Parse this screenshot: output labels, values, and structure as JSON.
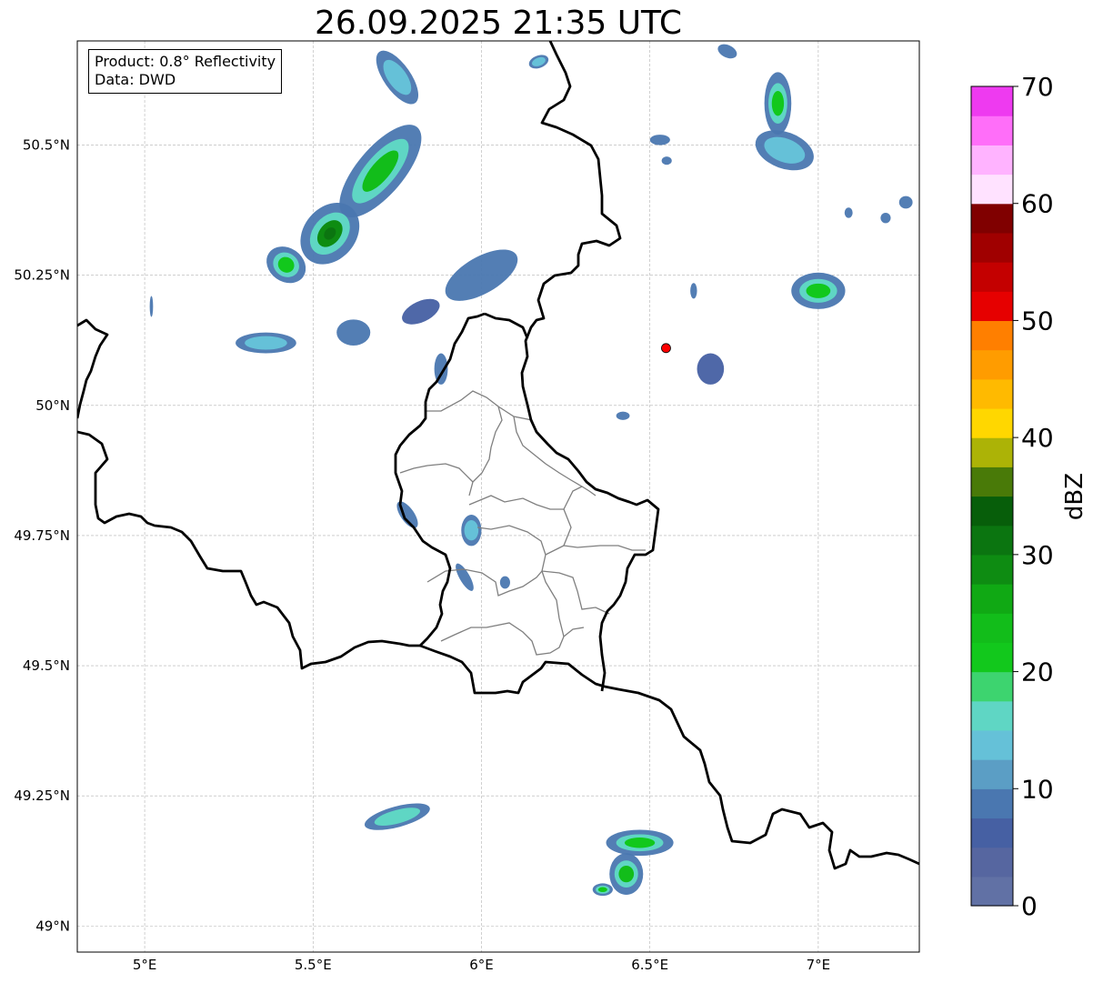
{
  "title": "26.09.2025 21:35 UTC",
  "info": {
    "product": "Product: 0.8° Reflectivity",
    "data": "Data: DWD"
  },
  "map": {
    "lon_range": [
      4.8,
      7.3
    ],
    "lat_range": [
      48.95,
      50.7
    ],
    "x_ticks": [
      {
        "value": 5.0,
        "label": "5°E"
      },
      {
        "value": 5.5,
        "label": "5.5°E"
      },
      {
        "value": 6.0,
        "label": "6°E"
      },
      {
        "value": 6.5,
        "label": "6.5°E"
      },
      {
        "value": 7.0,
        "label": "7°E"
      }
    ],
    "y_ticks": [
      {
        "value": 49.0,
        "label": "49°N"
      },
      {
        "value": 49.25,
        "label": "49.25°N"
      },
      {
        "value": 49.5,
        "label": "49.5°N"
      },
      {
        "value": 49.75,
        "label": "49.75°N"
      },
      {
        "value": 50.0,
        "label": "50°N"
      },
      {
        "value": 50.25,
        "label": "50.25°N"
      },
      {
        "value": 50.5,
        "label": "50.5°N"
      }
    ],
    "grid": true,
    "radar_site": {
      "lon": 6.548,
      "lat": 50.11,
      "color": "#ff0000"
    },
    "echoes": [
      {
        "lon": 5.75,
        "lat": 50.63,
        "rx": 0.04,
        "ry": 0.06,
        "dbz": 14,
        "angle": -35
      },
      {
        "lon": 5.7,
        "lat": 50.45,
        "rx": 0.17,
        "ry": 0.045,
        "dbz": 24,
        "angle": -50
      },
      {
        "lon": 5.55,
        "lat": 50.33,
        "rx": 0.1,
        "ry": 0.05,
        "dbz": 28,
        "angle": -50
      },
      {
        "lon": 5.42,
        "lat": 50.27,
        "rx": 0.05,
        "ry": 0.04,
        "dbz": 22,
        "angle": -55
      },
      {
        "lon": 5.36,
        "lat": 50.12,
        "rx": 0.09,
        "ry": 0.02,
        "dbz": 14,
        "angle": 0
      },
      {
        "lon": 5.62,
        "lat": 50.14,
        "rx": 0.05,
        "ry": 0.025,
        "dbz": 8,
        "angle": 0
      },
      {
        "lon": 5.02,
        "lat": 50.19,
        "rx": 0.005,
        "ry": 0.02,
        "dbz": 8,
        "angle": 0
      },
      {
        "lon": 6.0,
        "lat": 50.25,
        "rx": 0.12,
        "ry": 0.035,
        "dbz": 9,
        "angle": -30
      },
      {
        "lon": 5.82,
        "lat": 50.18,
        "rx": 0.06,
        "ry": 0.02,
        "dbz": 7,
        "angle": -25
      },
      {
        "lon": 5.88,
        "lat": 50.07,
        "rx": 0.02,
        "ry": 0.03,
        "dbz": 8,
        "angle": 0
      },
      {
        "lon": 5.78,
        "lat": 49.79,
        "rx": 0.02,
        "ry": 0.03,
        "dbz": 10,
        "angle": -35
      },
      {
        "lon": 5.97,
        "lat": 49.76,
        "rx": 0.03,
        "ry": 0.03,
        "dbz": 14,
        "angle": 0
      },
      {
        "lon": 5.95,
        "lat": 49.67,
        "rx": 0.015,
        "ry": 0.03,
        "dbz": 12,
        "angle": -30
      },
      {
        "lon": 6.07,
        "lat": 49.66,
        "rx": 0.015,
        "ry": 0.012,
        "dbz": 8,
        "angle": 0
      },
      {
        "lon": 6.17,
        "lat": 50.66,
        "rx": 0.03,
        "ry": 0.012,
        "dbz": 14,
        "angle": -20
      },
      {
        "lon": 6.88,
        "lat": 50.58,
        "rx": 0.04,
        "ry": 0.06,
        "dbz": 22,
        "angle": 0
      },
      {
        "lon": 6.9,
        "lat": 50.49,
        "rx": 0.09,
        "ry": 0.035,
        "dbz": 14,
        "angle": 20
      },
      {
        "lon": 6.73,
        "lat": 50.68,
        "rx": 0.03,
        "ry": 0.012,
        "dbz": 8,
        "angle": 25
      },
      {
        "lon": 6.53,
        "lat": 50.51,
        "rx": 0.03,
        "ry": 0.01,
        "dbz": 8,
        "angle": 0
      },
      {
        "lon": 6.55,
        "lat": 50.47,
        "rx": 0.015,
        "ry": 0.008,
        "dbz": 8,
        "angle": 0
      },
      {
        "lon": 7.0,
        "lat": 50.22,
        "rx": 0.08,
        "ry": 0.035,
        "dbz": 20,
        "angle": 0
      },
      {
        "lon": 6.68,
        "lat": 50.07,
        "rx": 0.04,
        "ry": 0.03,
        "dbz": 6,
        "angle": 0
      },
      {
        "lon": 6.63,
        "lat": 50.22,
        "rx": 0.01,
        "ry": 0.015,
        "dbz": 10,
        "angle": 0
      },
      {
        "lon": 7.26,
        "lat": 50.39,
        "rx": 0.02,
        "ry": 0.012,
        "dbz": 12,
        "angle": 0
      },
      {
        "lon": 7.2,
        "lat": 50.36,
        "rx": 0.015,
        "ry": 0.01,
        "dbz": 8,
        "angle": 0
      },
      {
        "lon": 7.09,
        "lat": 50.37,
        "rx": 0.012,
        "ry": 0.01,
        "dbz": 8,
        "angle": 0
      },
      {
        "lon": 6.42,
        "lat": 49.98,
        "rx": 0.02,
        "ry": 0.008,
        "dbz": 12,
        "angle": 0
      },
      {
        "lon": 5.75,
        "lat": 49.21,
        "rx": 0.1,
        "ry": 0.02,
        "dbz": 16,
        "angle": -15
      },
      {
        "lon": 6.47,
        "lat": 49.16,
        "rx": 0.1,
        "ry": 0.025,
        "dbz": 22,
        "angle": 0
      },
      {
        "lon": 6.43,
        "lat": 49.1,
        "rx": 0.05,
        "ry": 0.04,
        "dbz": 24,
        "angle": 0
      },
      {
        "lon": 6.36,
        "lat": 49.07,
        "rx": 0.03,
        "ry": 0.012,
        "dbz": 20,
        "angle": 0
      }
    ]
  },
  "colorbar": {
    "label": "dBZ",
    "range": [
      0,
      70
    ],
    "ticks": [
      {
        "value": 0,
        "label": "0"
      },
      {
        "value": 10,
        "label": "10"
      },
      {
        "value": 20,
        "label": "20"
      },
      {
        "value": 30,
        "label": "30"
      },
      {
        "value": 40,
        "label": "40"
      },
      {
        "value": 50,
        "label": "50"
      },
      {
        "value": 60,
        "label": "60"
      },
      {
        "value": 70,
        "label": "70"
      }
    ],
    "colors": [
      "#6171a5",
      "#5666a0",
      "#4660a3",
      "#4a77b0",
      "#5b9ec5",
      "#65c1d8",
      "#5fd6c4",
      "#3dd46f",
      "#12c81c",
      "#12bd1a",
      "#10a914",
      "#0e8c12",
      "#0b7510",
      "#075e0a",
      "#497a08",
      "#acb306",
      "#ffd700",
      "#ffba00",
      "#ff9c00",
      "#ff7f00",
      "#e60000",
      "#c40000",
      "#a00000",
      "#800000",
      "#ffe2ff",
      "#ffb3ff",
      "#ff6ef9",
      "#ee3af0"
    ]
  }
}
